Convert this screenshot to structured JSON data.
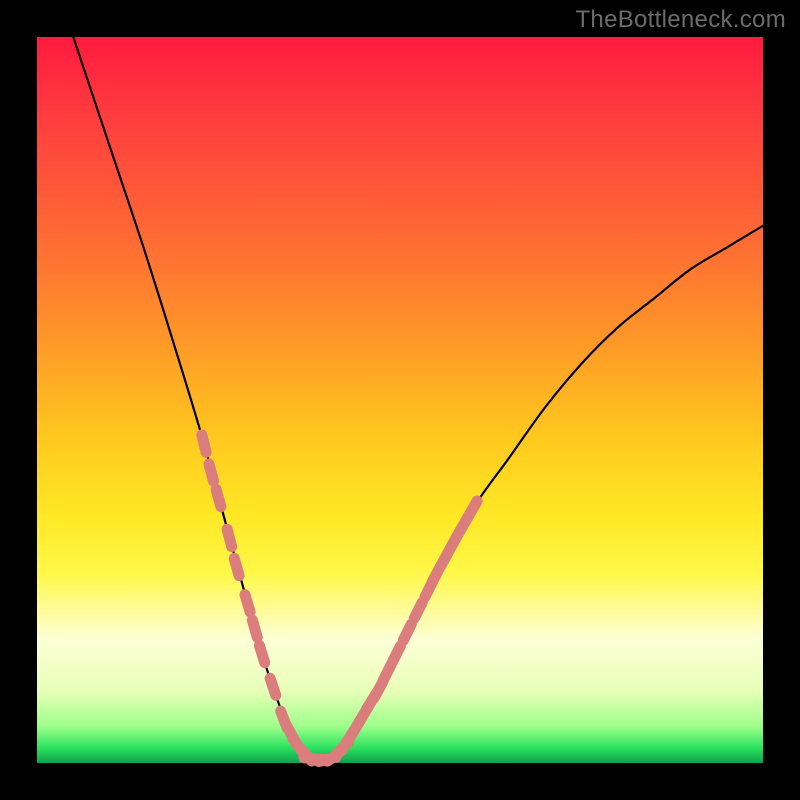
{
  "watermark": "TheBottleneck.com",
  "chart_data": {
    "type": "line",
    "title": "",
    "xlabel": "",
    "ylabel": "",
    "xlim": [
      0,
      100
    ],
    "ylim": [
      0,
      100
    ],
    "grid": false,
    "series": [
      {
        "name": "bottleneck-curve",
        "x": [
          5,
          10,
          15,
          20,
          23,
          26,
          29,
          31,
          33,
          35,
          36.5,
          38,
          40,
          42,
          44,
          47,
          50,
          55,
          60,
          65,
          70,
          75,
          80,
          85,
          90,
          95,
          100
        ],
        "values": [
          100,
          85,
          70,
          54,
          44,
          33,
          22,
          15,
          9,
          4,
          1.5,
          0.5,
          0.5,
          2,
          5,
          10,
          16,
          26,
          35,
          42,
          49,
          55,
          60,
          64,
          68,
          71,
          74
        ],
        "color": "#000000"
      }
    ],
    "overlays": [
      {
        "name": "pink-dashes-left",
        "type": "marker-dash",
        "color": "#db7d7d",
        "points": [
          {
            "x": 23,
            "y": 44
          },
          {
            "x": 24,
            "y": 40
          },
          {
            "x": 25,
            "y": 36.5
          },
          {
            "x": 26.5,
            "y": 31
          },
          {
            "x": 27.5,
            "y": 27
          },
          {
            "x": 29,
            "y": 22
          },
          {
            "x": 30,
            "y": 18.5
          },
          {
            "x": 31,
            "y": 15
          },
          {
            "x": 32.5,
            "y": 10.5
          },
          {
            "x": 34,
            "y": 6
          },
          {
            "x": 35,
            "y": 4
          },
          {
            "x": 36,
            "y": 2.3
          },
          {
            "x": 37,
            "y": 1.2
          }
        ]
      },
      {
        "name": "pink-dashes-bottom",
        "type": "marker-dash",
        "color": "#db7d7d",
        "points": [
          {
            "x": 38,
            "y": 0.6
          },
          {
            "x": 39,
            "y": 0.5
          },
          {
            "x": 40,
            "y": 0.5
          },
          {
            "x": 41,
            "y": 1.0
          },
          {
            "x": 42,
            "y": 2.0
          }
        ]
      },
      {
        "name": "pink-dashes-right",
        "type": "marker-dash",
        "color": "#db7d7d",
        "points": [
          {
            "x": 43,
            "y": 3.4
          },
          {
            "x": 44,
            "y": 5.0
          },
          {
            "x": 45,
            "y": 6.7
          },
          {
            "x": 46,
            "y": 8.4
          },
          {
            "x": 47,
            "y": 10.0
          },
          {
            "x": 48.2,
            "y": 12.4
          },
          {
            "x": 49.5,
            "y": 15.0
          },
          {
            "x": 51,
            "y": 18.0
          },
          {
            "x": 52.5,
            "y": 21.0
          },
          {
            "x": 54,
            "y": 24.0
          },
          {
            "x": 55,
            "y": 26.0
          },
          {
            "x": 56.3,
            "y": 28.4
          },
          {
            "x": 57.5,
            "y": 30.6
          },
          {
            "x": 58.8,
            "y": 32.9
          },
          {
            "x": 60,
            "y": 35.0
          }
        ]
      }
    ]
  }
}
